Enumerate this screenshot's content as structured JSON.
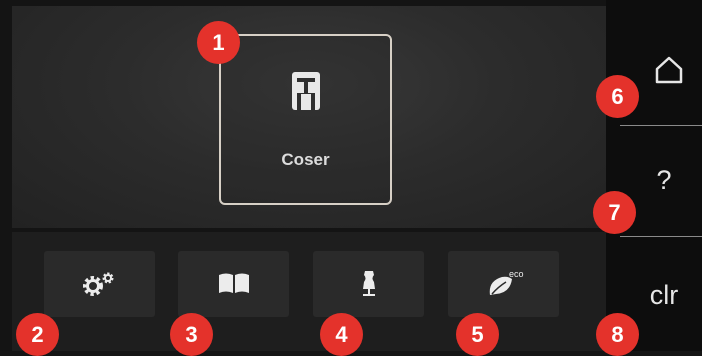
{
  "main": {
    "sew_tile": {
      "label": "Coser",
      "icon": "presser-foot-icon"
    }
  },
  "toolbar": {
    "buttons": [
      {
        "icon": "gears-icon"
      },
      {
        "icon": "book-icon"
      },
      {
        "icon": "dress-form-icon"
      },
      {
        "icon": "eco-leaf-icon",
        "badge": "eco"
      }
    ]
  },
  "sidebar": {
    "home_icon": "home-icon",
    "help_label": "?",
    "clear_label": "clr"
  },
  "callouts": [
    "1",
    "2",
    "3",
    "4",
    "5",
    "6",
    "7",
    "8"
  ],
  "colors": {
    "callout": "#e4322b",
    "background": "#141414",
    "tile_border": "#d7d0c6"
  }
}
